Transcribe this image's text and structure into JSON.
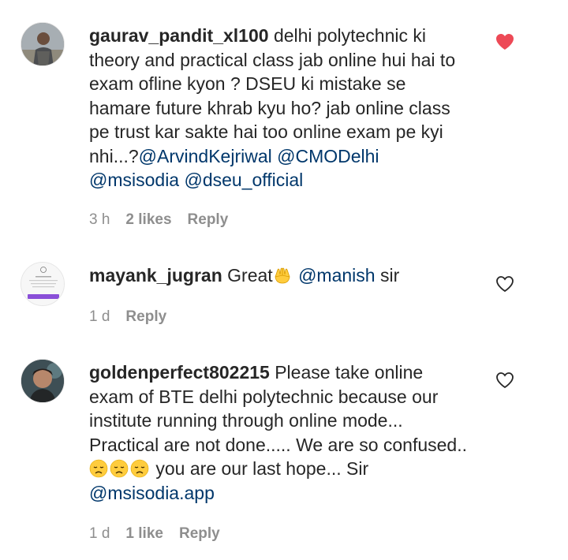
{
  "comments": [
    {
      "username": "gaurav_pandit_xl100",
      "text_parts": [
        " delhi polytechnic ki theory and practical class jab online hui hai to exam ofline kyon ? DSEU ki mistake se hamare future khrab kyu ho? jab online class pe trust kar sakte hai too online exam pe kyi nhi...?"
      ],
      "mentions": [
        "@ArvindKejriwal",
        "@CMODelhi",
        "@msisodia",
        "@dseu_official"
      ],
      "time": "3 h",
      "likes": "2 likes",
      "reply": "Reply",
      "liked": true
    },
    {
      "username": "mayank_jugran",
      "text_before": " Great",
      "emoji": "raising-hands-emoji",
      "mention": "@manish",
      "text_after": " sir",
      "time": "1 d",
      "reply": "Reply",
      "liked": false
    },
    {
      "username": "goldenperfect802215",
      "text_before": " Please take online exam of BTE delhi polytechnic because our institute running through online mode... Practical are not done..... We are so confused.. ",
      "emoji": "disappointed-face-emoji",
      "emoji_count": 3,
      "text_after": " you are our last hope... Sir ",
      "mention": "@msisodia.app",
      "time": "1 d",
      "likes": "1 like",
      "reply": "Reply",
      "liked": false
    }
  ],
  "colors": {
    "liked_heart": "#ed4956",
    "mention": "#00376b",
    "meta": "#8e8e8e"
  }
}
